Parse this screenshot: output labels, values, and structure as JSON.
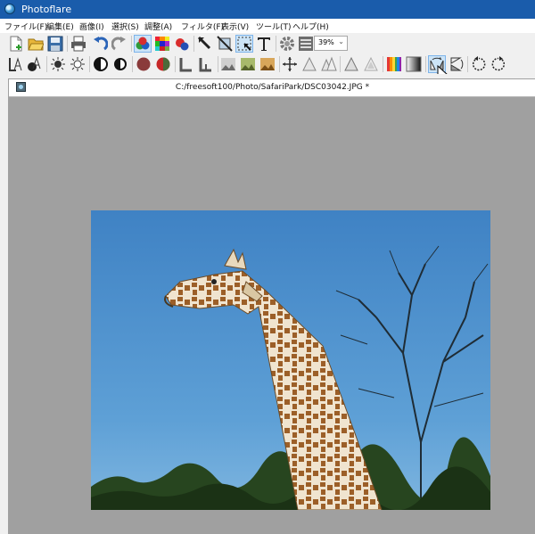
{
  "window": {
    "title": "Photoflare"
  },
  "menu": [
    "ファイル(F)",
    "編集(E)",
    "画像(I)",
    "選択(S)",
    "調整(A)",
    "フィルタ(F)",
    "表示(V)",
    "ツール(T)",
    "ヘルプ(H)"
  ],
  "toolbar": {
    "zoom_value": "39%"
  },
  "document": {
    "title": "C:/freesoft100/Photo/SafariPark/DSC03042.JPG *"
  },
  "colors": {
    "titlebar": "#1a5cab",
    "workspace": "#a0a0a0",
    "selected_tool": "#cce4f7"
  }
}
